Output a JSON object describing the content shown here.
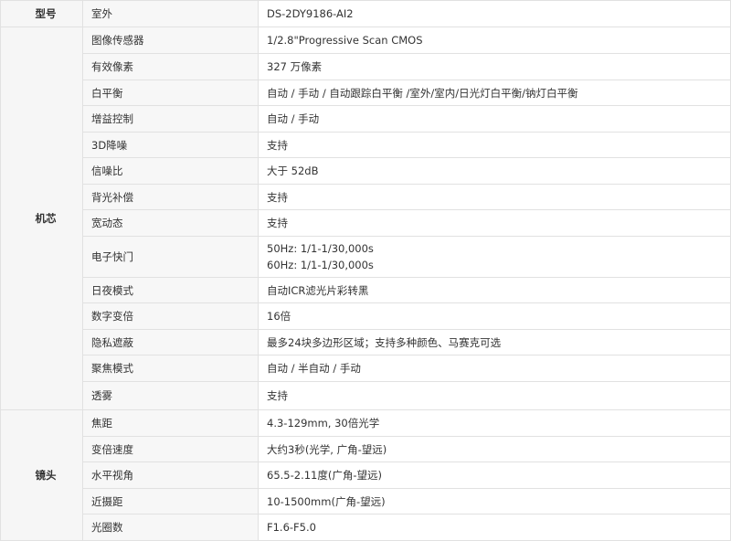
{
  "model": {
    "label": "型号",
    "name": "室外",
    "value": "DS-2DY9186-AI2"
  },
  "core": {
    "group": "机芯",
    "rows": [
      {
        "name": "图像传感器",
        "value": "1/2.8\"Progressive Scan CMOS"
      },
      {
        "name": "有效像素",
        "value": "327 万像素"
      },
      {
        "name": "白平衡",
        "value": "自动 / 手动 / 自动跟踪白平衡 /室外/室内/日光灯白平衡/钠灯白平衡"
      },
      {
        "name": "增益控制",
        "value": "自动 / 手动"
      },
      {
        "name": "3D降噪",
        "value": "支持"
      },
      {
        "name": "信噪比",
        "value": "大于 52dB"
      },
      {
        "name": "背光补偿",
        "value": "支持"
      },
      {
        "name": "宽动态",
        "value": "支持"
      },
      {
        "name": "电子快门",
        "value_lines": [
          "50Hz: 1/1-1/30,000s",
          "60Hz: 1/1-1/30,000s"
        ]
      },
      {
        "name": "日夜模式",
        "value": "自动ICR滤光片彩转黑"
      },
      {
        "name": "数字变倍",
        "value": "16倍"
      },
      {
        "name": "隐私遮蔽",
        "value": "最多24块多边形区域；支持多种颜色、马赛克可选"
      },
      {
        "name": "聚焦模式",
        "value": "自动 / 半自动 / 手动"
      },
      {
        "name": "透雾",
        "value": "支持"
      }
    ]
  },
  "lens": {
    "group": "镜头",
    "rows": [
      {
        "name": "焦距",
        "value": "4.3-129mm, 30倍光学"
      },
      {
        "name": "变倍速度",
        "value": "大约3秒(光学, 广角-望远)"
      },
      {
        "name": "水平视角",
        "value": "65.5-2.11度(广角-望远)"
      },
      {
        "name": "近摄距",
        "value": "10-1500mm(广角-望远)"
      },
      {
        "name": "光圈数",
        "value": "F1.6-F5.0"
      }
    ]
  }
}
